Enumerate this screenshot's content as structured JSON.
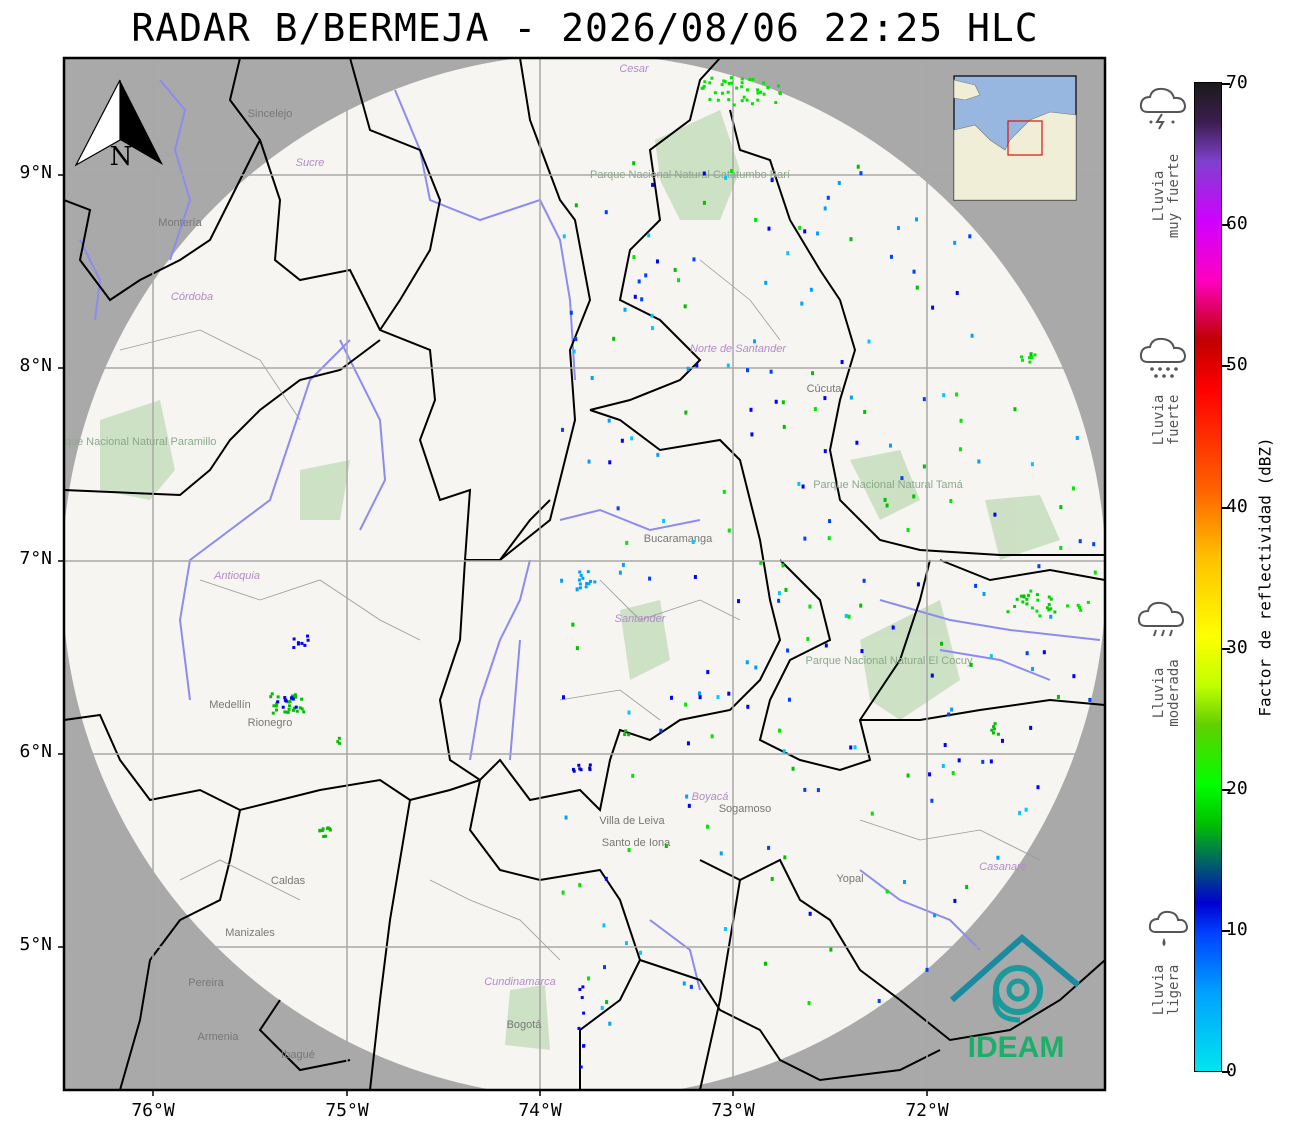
{
  "title": "RADAR B/BERMEJA - 2026/08/06 22:25 HLC",
  "latitude_labels": [
    "9°N",
    "8°N",
    "7°N",
    "6°N",
    "5°N"
  ],
  "longitude_labels": [
    "76°W",
    "75°W",
    "74°W",
    "73°W",
    "72°W"
  ],
  "north_arrow_letter": "N",
  "logo_text": "IDEAM",
  "map_places": {
    "regions": [
      "Sucre",
      "Córdoba",
      "Antioquia",
      "Norte de Santander",
      "Santander",
      "Boyacá",
      "Casanare",
      "Cundinamarca",
      "Cesar"
    ],
    "cities": [
      "Montería",
      "Medellín",
      "Bucaramanga",
      "Cúcuta",
      "Sogamoso",
      "Villa de Leiva",
      "Santo de Iona",
      "Ibagué",
      "Bogotá",
      "Manizales",
      "Pereira",
      "Armenia",
      "Rionegro",
      "Caldas",
      "Yopal",
      "Sincelejo"
    ],
    "parks": [
      "Parque Nacional Natural Paramillo",
      "Parque Nacional Natural Catatumbo Barí",
      "Parque Nacional Natural El Cocuy",
      "Parque Nacional Natural Tamá"
    ]
  },
  "colorbar": {
    "label": "Factor de reflectividad (dBZ)",
    "ticks": [
      "0",
      "10",
      "20",
      "30",
      "40",
      "50",
      "60",
      "70"
    ]
  },
  "rain_categories": [
    {
      "line1": "Lluvia",
      "line2": "muy fuerte"
    },
    {
      "line1": "Lluvia",
      "line2": "fuerte"
    },
    {
      "line1": "Lluvia",
      "line2": "moderada"
    },
    {
      "line1": "Lluvia",
      "line2": "ligera"
    }
  ]
}
